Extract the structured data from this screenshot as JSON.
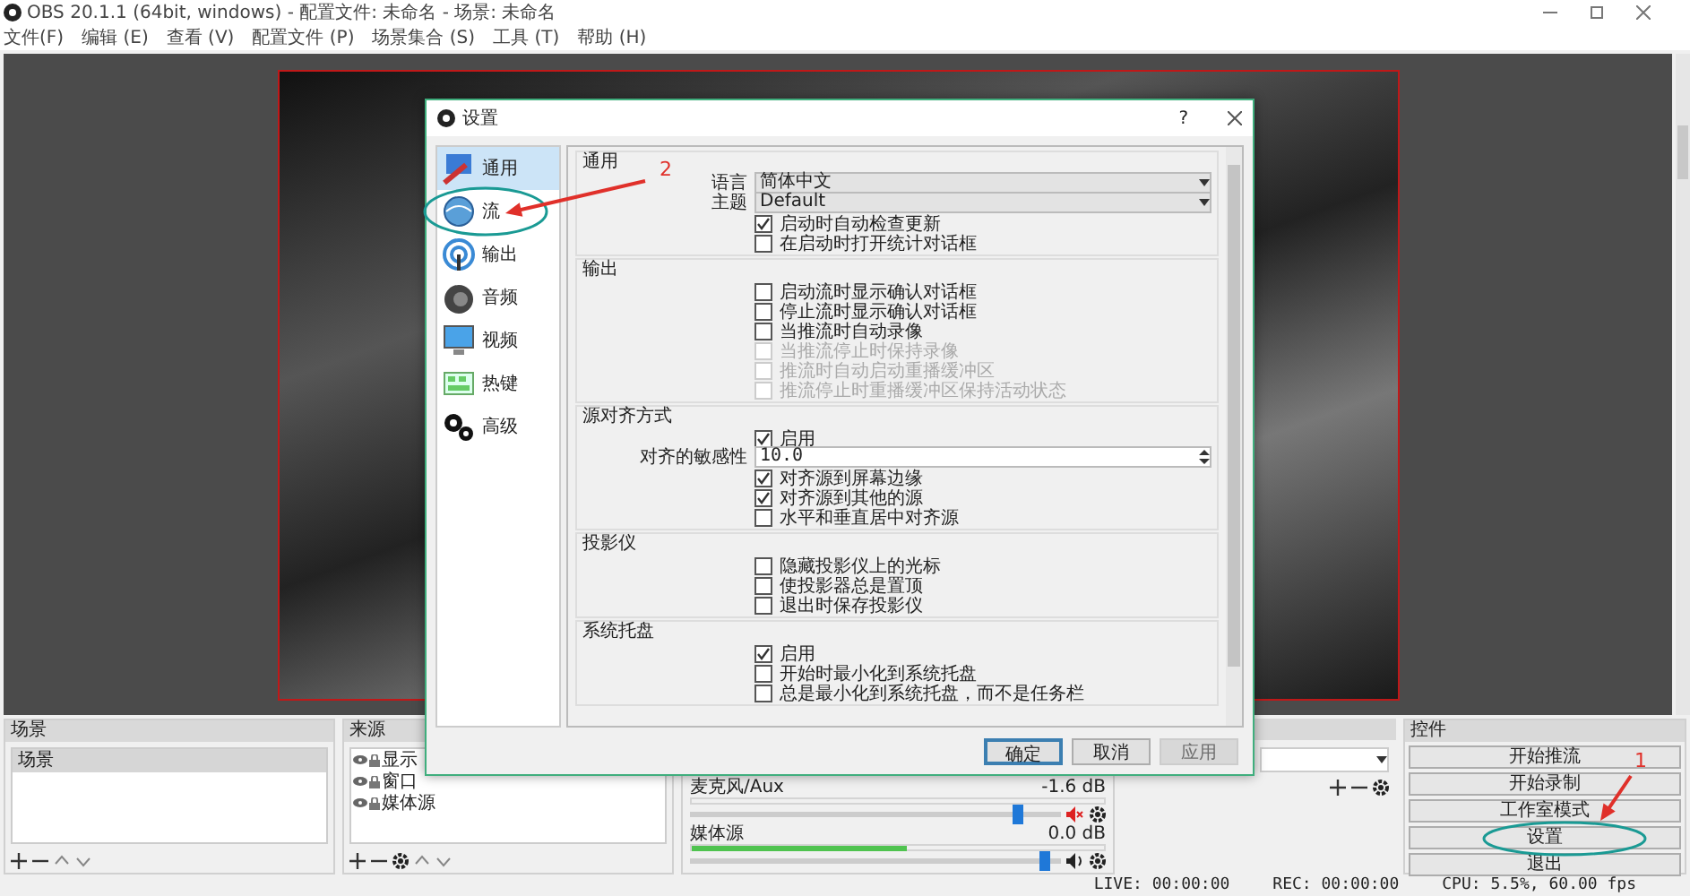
{
  "window": {
    "title": "OBS 20.1.1 (64bit, windows) - 配置文件: 未命名 - 场景: 未命名"
  },
  "menu": [
    "文件(F)",
    "编辑 (E)",
    "查看 (V)",
    "配置文件 (P)",
    "场景集合 (S)",
    "工具 (T)",
    "帮助 (H)"
  ],
  "scenes": {
    "title": "场景",
    "items": [
      {
        "label": "场景",
        "selected": true
      }
    ]
  },
  "sources": {
    "title": "来源",
    "items": [
      "显示",
      "窗口",
      "媒体源"
    ]
  },
  "mixer": {
    "channels": [
      {
        "name": "麦克风/Aux",
        "reading": "-1.6 dB",
        "muted": true,
        "volume": {
          "level": 0.9
        }
      },
      {
        "name": "媒体源",
        "reading": "0.0 dB",
        "muted": false,
        "meter": {
          "level": 0.52
        },
        "volume": {
          "level": 0.97
        }
      }
    ]
  },
  "controls": {
    "title": "控件",
    "buttons": [
      "开始推流",
      "开始录制",
      "工作室模式",
      "设置",
      "退出"
    ]
  },
  "status_bar": {
    "live": "LIVE: 00:00:00",
    "rec": "REC: 00:00:00",
    "cpu": "CPU: 5.5%, 60.00 fps"
  },
  "settings_dialog": {
    "title": "设置",
    "help": "?",
    "categories": [
      {
        "label": "通用",
        "selected": true
      },
      {
        "label": "流",
        "selected": false
      },
      {
        "label": "输出",
        "selected": false
      },
      {
        "label": "音频",
        "selected": false
      },
      {
        "label": "视频",
        "selected": false
      },
      {
        "label": "热键",
        "selected": false
      },
      {
        "label": "高级",
        "selected": false
      }
    ],
    "groups": [
      {
        "title": "通用",
        "items": [
          {
            "kind": "dropdown",
            "label": "语言",
            "value": "简体中文"
          },
          {
            "kind": "dropdown",
            "label": "主题",
            "value": "Default"
          },
          {
            "kind": "checkbox",
            "label": "启动时自动检查更新",
            "checked": true,
            "disabled": false
          },
          {
            "kind": "checkbox",
            "label": "在启动时打开统计对话框",
            "checked": false,
            "disabled": false
          }
        ]
      },
      {
        "title": "输出",
        "items": [
          {
            "kind": "checkbox",
            "label": "启动流时显示确认对话框",
            "checked": false,
            "disabled": false
          },
          {
            "kind": "checkbox",
            "label": "停止流时显示确认对话框",
            "checked": false,
            "disabled": false
          },
          {
            "kind": "checkbox",
            "label": "当推流时自动录像",
            "checked": false,
            "disabled": false
          },
          {
            "kind": "checkbox",
            "label": "当推流停止时保持录像",
            "checked": false,
            "disabled": true
          },
          {
            "kind": "checkbox",
            "label": "推流时自动启动重播缓冲区",
            "checked": false,
            "disabled": true
          },
          {
            "kind": "checkbox",
            "label": "推流停止时重播缓冲区保持活动状态",
            "checked": false,
            "disabled": true
          }
        ]
      },
      {
        "title": "源对齐方式",
        "items": [
          {
            "kind": "checkbox",
            "label": "启用",
            "checked": true,
            "disabled": false
          },
          {
            "kind": "spinner",
            "label": "对齐的敏感性",
            "value": "10.0"
          },
          {
            "kind": "checkbox",
            "label": "对齐源到屏幕边缘",
            "checked": true,
            "disabled": false
          },
          {
            "kind": "checkbox",
            "label": "对齐源到其他的源",
            "checked": true,
            "disabled": false
          },
          {
            "kind": "checkbox",
            "label": "水平和垂直居中对齐源",
            "checked": false,
            "disabled": false
          }
        ]
      },
      {
        "title": "投影仪",
        "items": [
          {
            "kind": "checkbox",
            "label": "隐藏投影仪上的光标",
            "checked": false,
            "disabled": false
          },
          {
            "kind": "checkbox",
            "label": "使投影器总是置顶",
            "checked": false,
            "disabled": false
          },
          {
            "kind": "checkbox",
            "label": "退出时保存投影仪",
            "checked": false,
            "disabled": false
          }
        ]
      },
      {
        "title": "系统托盘",
        "items": [
          {
            "kind": "checkbox",
            "label": "启用",
            "checked": true,
            "disabled": false
          },
          {
            "kind": "checkbox",
            "label": "开始时最小化到系统托盘",
            "checked": false,
            "disabled": false
          },
          {
            "kind": "checkbox",
            "label": "总是最小化到系统托盘，而不是任务栏",
            "checked": false,
            "disabled": false
          }
        ]
      }
    ],
    "buttons": [
      {
        "label": "确定",
        "default": true,
        "disabled": false
      },
      {
        "label": "取消",
        "default": false,
        "disabled": false
      },
      {
        "label": "应用",
        "default": false,
        "disabled": true
      }
    ]
  },
  "annotations": [
    {
      "label": "2"
    },
    {
      "label": "1"
    }
  ]
}
